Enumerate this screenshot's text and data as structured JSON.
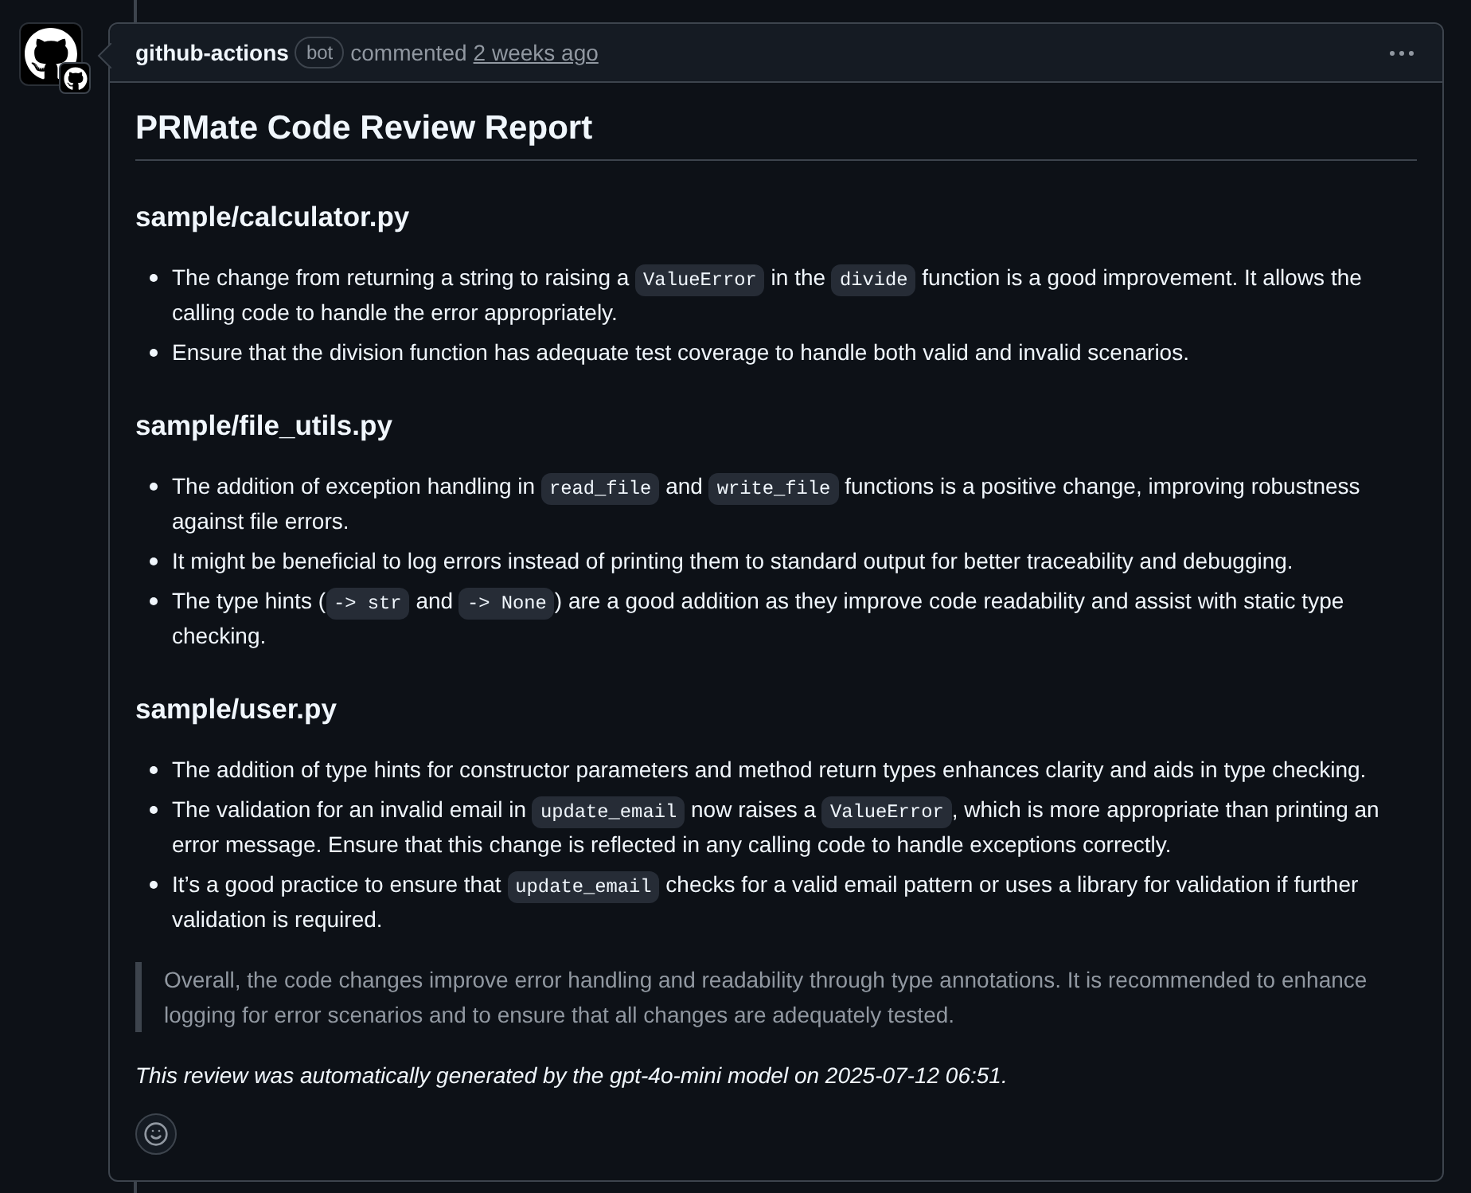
{
  "comment": {
    "author": "github-actions",
    "badge": "bot",
    "action": "commented",
    "time": "2 weeks ago"
  },
  "report": {
    "title": "PRMate Code Review Report",
    "sections": [
      {
        "heading": "sample/calculator.py",
        "items": [
          {
            "parts": [
              {
                "kind": "text",
                "text": "The change from returning a string to raising a "
              },
              {
                "kind": "code",
                "text": "ValueError"
              },
              {
                "kind": "text",
                "text": " in the "
              },
              {
                "kind": "code",
                "text": "divide"
              },
              {
                "kind": "text",
                "text": " function is a good improvement. It allows the calling code to handle the error appropriately."
              }
            ]
          },
          {
            "parts": [
              {
                "kind": "text",
                "text": "Ensure that the division function has adequate test coverage to handle both valid and invalid scenarios."
              }
            ]
          }
        ]
      },
      {
        "heading": "sample/file_utils.py",
        "items": [
          {
            "parts": [
              {
                "kind": "text",
                "text": "The addition of exception handling in "
              },
              {
                "kind": "code",
                "text": "read_file"
              },
              {
                "kind": "text",
                "text": " and "
              },
              {
                "kind": "code",
                "text": "write_file"
              },
              {
                "kind": "text",
                "text": " functions is a positive change, improving robustness against file errors."
              }
            ]
          },
          {
            "parts": [
              {
                "kind": "text",
                "text": "It might be beneficial to log errors instead of printing them to standard output for better traceability and debugging."
              }
            ]
          },
          {
            "parts": [
              {
                "kind": "text",
                "text": "The type hints ("
              },
              {
                "kind": "code",
                "text": "-> str"
              },
              {
                "kind": "text",
                "text": " and "
              },
              {
                "kind": "code",
                "text": "-> None"
              },
              {
                "kind": "text",
                "text": ") are a good addition as they improve code readability and assist with static type checking."
              }
            ]
          }
        ]
      },
      {
        "heading": "sample/user.py",
        "items": [
          {
            "parts": [
              {
                "kind": "text",
                "text": "The addition of type hints for constructor parameters and method return types enhances clarity and aids in type checking."
              }
            ]
          },
          {
            "parts": [
              {
                "kind": "text",
                "text": "The validation for an invalid email in "
              },
              {
                "kind": "code",
                "text": "update_email"
              },
              {
                "kind": "text",
                "text": " now raises a "
              },
              {
                "kind": "code",
                "text": "ValueError"
              },
              {
                "kind": "text",
                "text": ", which is more appropriate than printing an error message. Ensure that this change is reflected in any calling code to handle exceptions correctly."
              }
            ]
          },
          {
            "parts": [
              {
                "kind": "text",
                "text": "It’s a good practice to ensure that "
              },
              {
                "kind": "code",
                "text": "update_email"
              },
              {
                "kind": "text",
                "text": " checks for a valid email pattern or uses a library for validation if further validation is required."
              }
            ]
          }
        ]
      }
    ],
    "summary": "Overall, the code changes improve error handling and readability through type annotations. It is recommended to enhance logging for error scenarios and to ensure that all changes are adequately tested.",
    "footer": "This review was automatically generated by the gpt-4o-mini model on 2025-07-12 06:51."
  }
}
